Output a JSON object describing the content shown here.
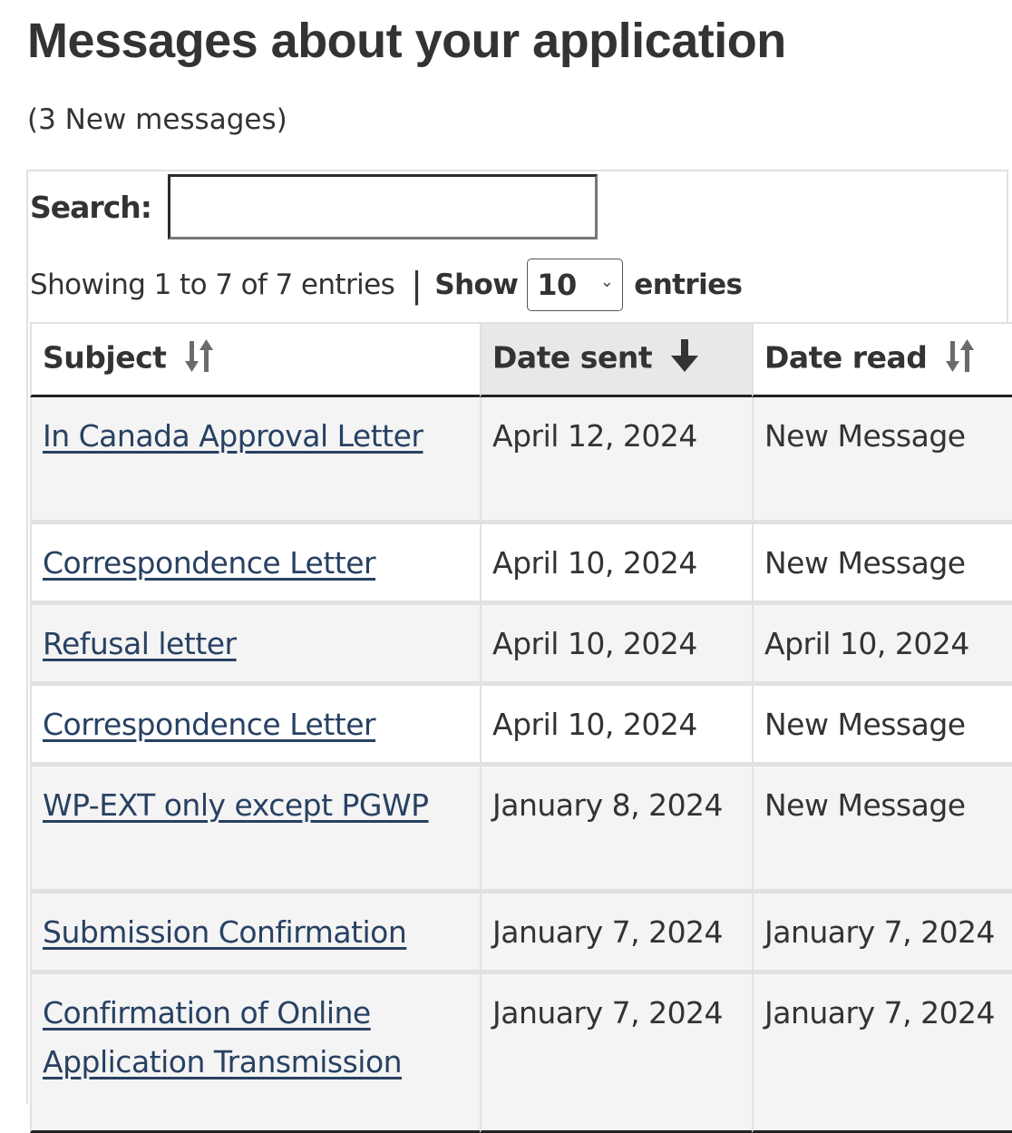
{
  "page": {
    "title": "Messages about your application",
    "new_count": "(3 New messages)"
  },
  "controls": {
    "search_label": "Search:",
    "search_value": "",
    "search_placeholder": "",
    "info_text": "Showing 1 to 7 of 7 entries",
    "divider": "|",
    "show_label": "Show",
    "page_length": "10",
    "entries_label": "entries"
  },
  "table": {
    "columns": [
      {
        "label": "Subject",
        "sort": "unsorted",
        "icon": "sort-both-icon"
      },
      {
        "label": "Date sent",
        "sort": "descending",
        "icon": "arrow-down-icon"
      },
      {
        "label": "Date read",
        "sort": "unsorted",
        "icon": "sort-both-icon"
      }
    ],
    "rows": [
      {
        "subject": "In Canada Approval Letter",
        "date_sent": "April 12, 2024",
        "date_read": "New Message"
      },
      {
        "subject": "Correspondence Letter",
        "date_sent": "April 10, 2024",
        "date_read": "New Message"
      },
      {
        "subject": "Refusal letter",
        "date_sent": "April 10, 2024",
        "date_read": "April 10, 2024"
      },
      {
        "subject": "Correspondence Letter",
        "date_sent": "April 10, 2024",
        "date_read": "New Message"
      },
      {
        "subject": "WP-EXT only except PGWP",
        "date_sent": "January 8, 2024",
        "date_read": "New Message"
      },
      {
        "subject": "Submission Confirmation",
        "date_sent": "January 7, 2024",
        "date_read": "January 7, 2024"
      },
      {
        "subject": "Confirmation of Online Application Transmission",
        "date_sent": "January 7, 2024",
        "date_read": "January 7, 2024"
      }
    ]
  },
  "colors": {
    "link": "#284162",
    "text": "#333333",
    "stripe": "#f4f4f4",
    "sorted_header": "#e8e8e8",
    "border": "#e1e1e1"
  }
}
